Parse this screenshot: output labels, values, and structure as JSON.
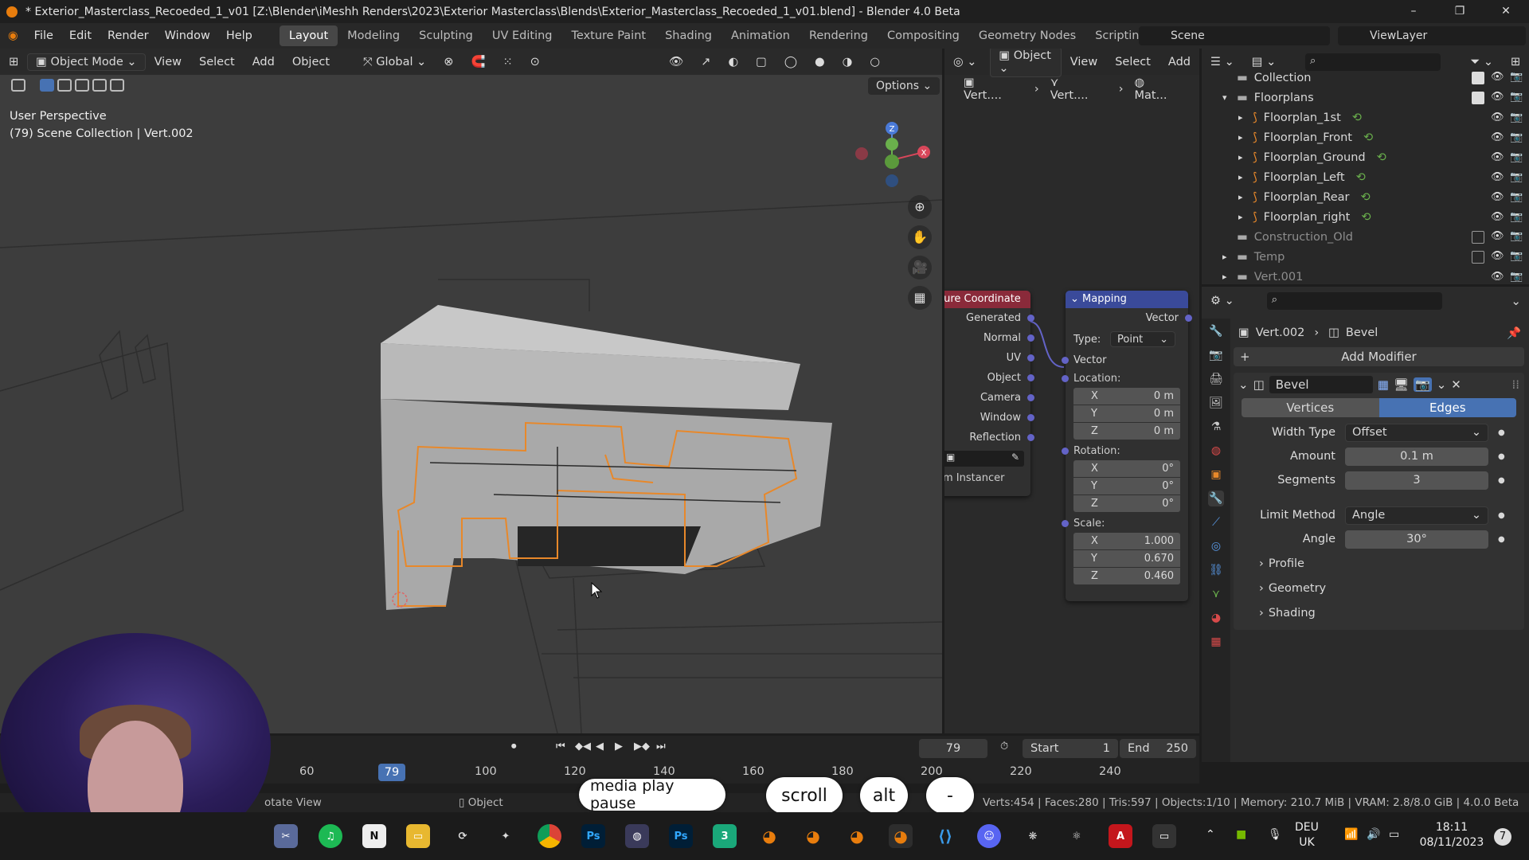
{
  "window": {
    "title": "* Exterior_Masterclass_Recoeded_1_v01 [Z:\\Blender\\iMeshh Renders\\2023\\Exterior Masterclass\\Blends\\Exterior_Masterclass_Recoeded_1_v01.blend] - Blender 4.0 Beta",
    "minimize": "–",
    "restore": "❐",
    "close": "✕"
  },
  "menu": {
    "items": [
      "File",
      "Edit",
      "Render",
      "Window",
      "Help"
    ],
    "workspaces": [
      "Layout",
      "Modeling",
      "Sculpting",
      "UV Editing",
      "Texture Paint",
      "Shading",
      "Animation",
      "Rendering",
      "Compositing",
      "Geometry Nodes",
      "Scripting",
      "+"
    ],
    "active_workspace": "Layout",
    "scene": "Scene",
    "view_layer": "ViewLayer"
  },
  "viewport": {
    "mode": "Object Mode",
    "view": "View",
    "select": "Select",
    "add": "Add",
    "object": "Object",
    "orientation": "Global",
    "options": "Options",
    "overlay_line1": "User Perspective",
    "overlay_line2": "(79) Scene Collection | Vert.002",
    "gizmo_z": "Z",
    "gizmo_x": "X"
  },
  "node_editor": {
    "header_object": "Object",
    "view": "View",
    "select": "Select",
    "add": "Add",
    "breadcrumb": [
      "Vert....",
      "Vert....",
      "Mat..."
    ],
    "texcoord_title": "ture Coordinate",
    "texcoord_outputs": [
      "Generated",
      "Normal",
      "UV",
      "Object",
      "Camera",
      "Window",
      "Reflection"
    ],
    "texcoord_footer": "m Instancer",
    "mapping_title": "Mapping",
    "mapping_output": "Vector",
    "type_label": "Type:",
    "type_value": "Point",
    "vector_input": "Vector",
    "location_label": "Location:",
    "location": [
      [
        "X",
        "0 m"
      ],
      [
        "Y",
        "0 m"
      ],
      [
        "Z",
        "0 m"
      ]
    ],
    "rotation_label": "Rotation:",
    "rotation": [
      [
        "X",
        "0°"
      ],
      [
        "Y",
        "0°"
      ],
      [
        "Z",
        "0°"
      ]
    ],
    "scale_label": "Scale:",
    "scale": [
      [
        "X",
        "1.000"
      ],
      [
        "Y",
        "0.670"
      ],
      [
        "Z",
        "0.460"
      ]
    ]
  },
  "outliner": {
    "rows": [
      {
        "name": "Collection",
        "indent": 0,
        "dim": false,
        "checked": true
      },
      {
        "name": "Floorplans",
        "indent": 0,
        "dim": false,
        "checked": true
      },
      {
        "name": "Floorplan_1st",
        "indent": 1,
        "dim": false
      },
      {
        "name": "Floorplan_Front",
        "indent": 1,
        "dim": false
      },
      {
        "name": "Floorplan_Ground",
        "indent": 1,
        "dim": false
      },
      {
        "name": "Floorplan_Left",
        "indent": 1,
        "dim": false
      },
      {
        "name": "Floorplan_Rear",
        "indent": 1,
        "dim": false
      },
      {
        "name": "Floorplan_right",
        "indent": 1,
        "dim": false
      },
      {
        "name": "Construction_Old",
        "indent": 0,
        "dim": true,
        "checked": false
      },
      {
        "name": "Temp",
        "indent": 0,
        "dim": true,
        "checked": false
      },
      {
        "name": "Vert.001",
        "indent": 0,
        "dim": true
      }
    ]
  },
  "properties": {
    "object": "Vert.002",
    "modifier_name_crumb": "Bevel",
    "add_modifier": "Add Modifier",
    "modifier_name": "Bevel",
    "affect_tabs": [
      "Vertices",
      "Edges"
    ],
    "active_affect": "Edges",
    "width_type_label": "Width Type",
    "width_type": "Offset",
    "amount_label": "Amount",
    "amount": "0.1 m",
    "segments_label": "Segments",
    "segments": "3",
    "limit_method_label": "Limit Method",
    "limit_method": "Angle",
    "angle_label": "Angle",
    "angle": "30°",
    "subpanels": [
      "Profile",
      "Geometry",
      "Shading"
    ]
  },
  "timeline": {
    "current_frame": "79",
    "start_label": "Start",
    "start": "1",
    "end_label": "End",
    "end": "250",
    "ticks": [
      "60",
      "79",
      "100",
      "120",
      "140",
      "160",
      "180",
      "200",
      "220",
      "240"
    ]
  },
  "statusbar": {
    "rotate_view": "otate View",
    "object": "Object",
    "stats": "Verts:454 | Faces:280 | Tris:597 | Objects:1/10 | Memory: 210.7 MiB | VRAM: 2.8/8.0 GiB | 4.0.0 Beta"
  },
  "keys": [
    "media play pause",
    "scroll",
    "alt",
    "-"
  ],
  "taskbar": {
    "apps": [
      "Ps",
      "Ps",
      "3"
    ],
    "lang_line1": "DEU",
    "lang_line2": "UK",
    "time": "18:11",
    "date": "08/11/2023",
    "notifications": "7"
  },
  "colors": {
    "accent_blue": "#4772b3",
    "selection_orange": "#e8882a",
    "mapping_header": "#3a4a9a",
    "texcoord_header": "#8a2a3a",
    "socket_purple": "#6363c7"
  }
}
